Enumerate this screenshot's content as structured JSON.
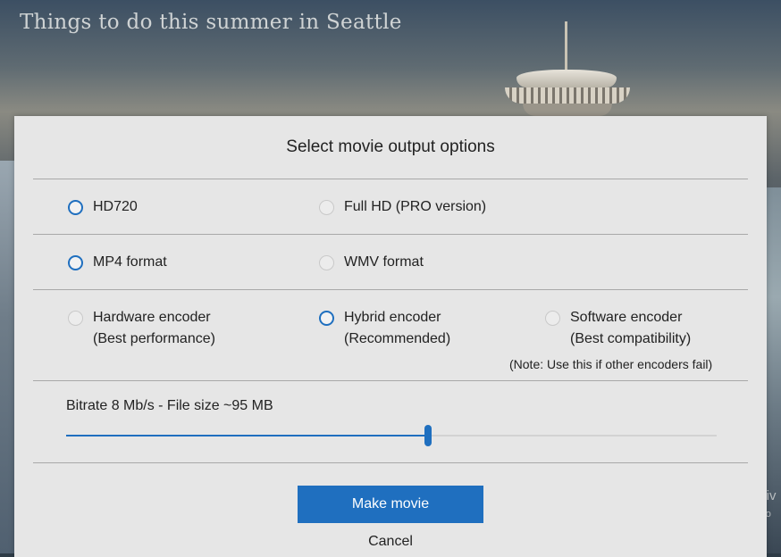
{
  "background": {
    "heading": "Things to do this summer in Seattle",
    "watermark_line1": "Activ",
    "watermark_line2": "Go to"
  },
  "dialog": {
    "title": "Select movie output options",
    "resolution_options": [
      {
        "label": "HD720",
        "selected": true
      },
      {
        "label": "Full HD (PRO version)",
        "selected": false
      }
    ],
    "format_options": [
      {
        "label": "MP4 format",
        "selected": true
      },
      {
        "label": "WMV format",
        "selected": false
      }
    ],
    "encoder_options": [
      {
        "label": "Hardware encoder",
        "sublabel": "(Best performance)",
        "selected": false
      },
      {
        "label": "Hybrid encoder",
        "sublabel": "(Recommended)",
        "selected": true
      },
      {
        "label": "Software encoder",
        "sublabel": "(Best compatibility)",
        "selected": false
      }
    ],
    "encoder_note": "(Note: Use this if other encoders fail)",
    "bitrate_label": "Bitrate 8 Mb/s - File size ~95 MB",
    "bitrate_slider_fraction": 0.556,
    "make_movie_label": "Make movie",
    "cancel_label": "Cancel"
  },
  "colors": {
    "accent": "#1f6fbf",
    "dialog_bg": "#e6e6e6"
  }
}
